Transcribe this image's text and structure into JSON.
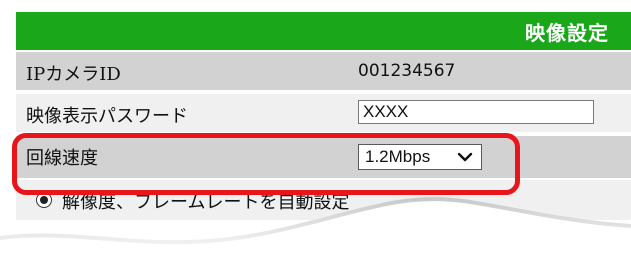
{
  "header": {
    "title": "映像設定"
  },
  "rows": [
    {
      "label": "IPカメラID",
      "value": "001234567"
    },
    {
      "label": "映像表示パスワード",
      "input_value": "XXXX"
    },
    {
      "label": "回線速度",
      "select_value": "1.2Mbps"
    }
  ],
  "option": {
    "label": "解像度、フレームレートを自動設定",
    "selected": true
  },
  "colors": {
    "header_bg": "#1aa81a",
    "highlight": "#e8161b",
    "row_dark": "#d2d2d2",
    "row_light": "#f0f0f0"
  }
}
